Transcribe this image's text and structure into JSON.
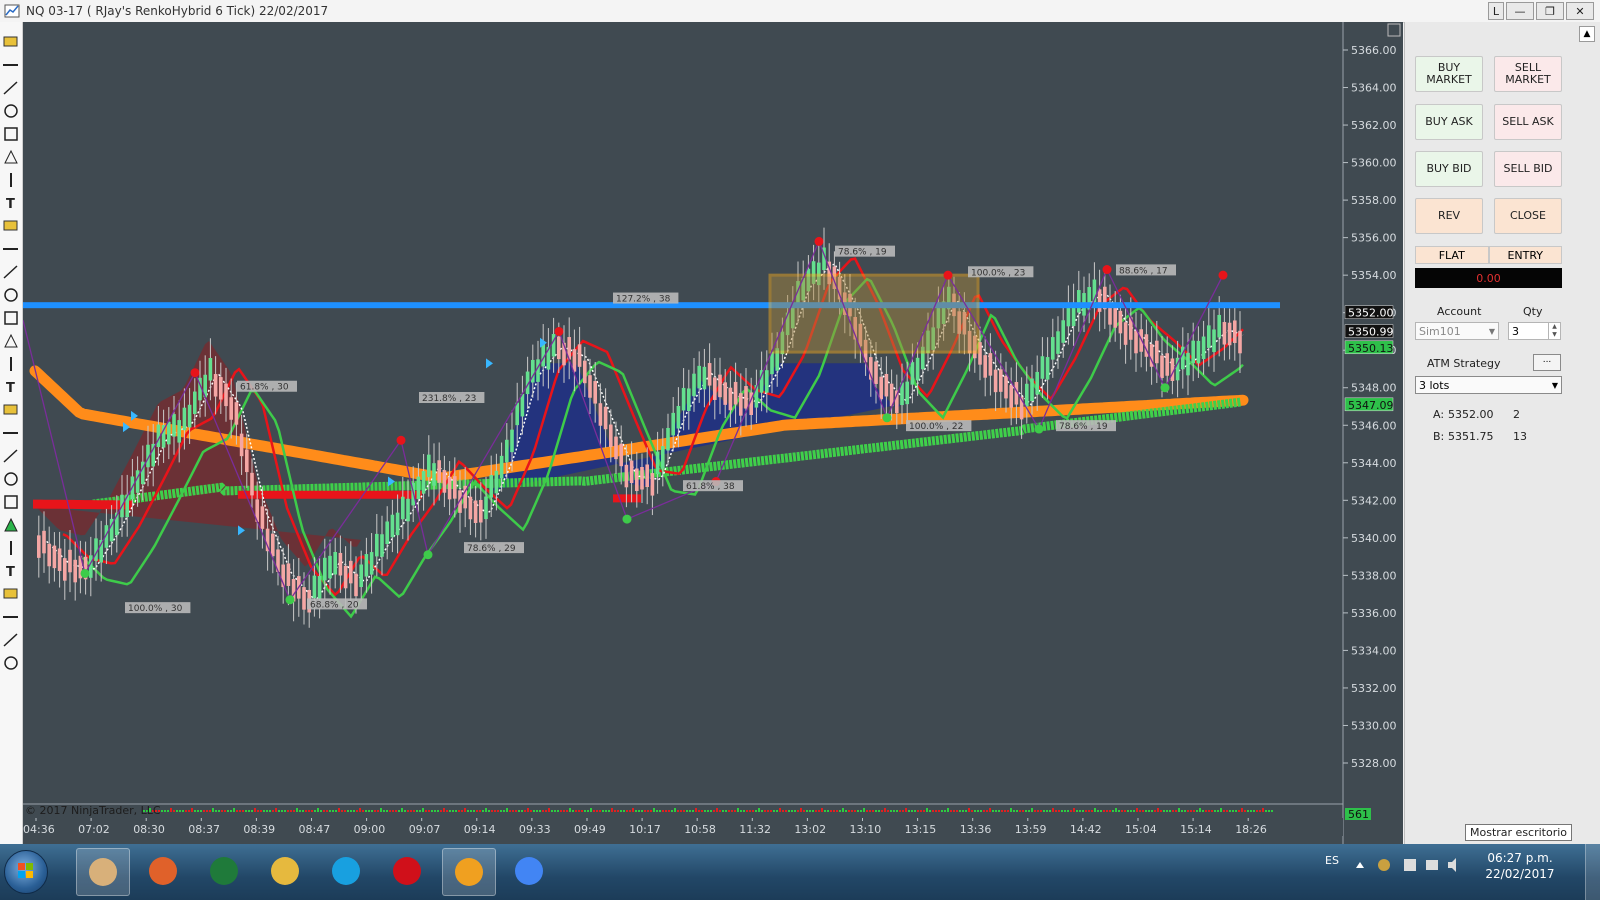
{
  "window": {
    "title": "NQ 03-17 ( RJay's RenkoHybrid  6 Tick)  22/02/2017",
    "buttons": [
      "L",
      "—",
      "❐",
      "✕"
    ]
  },
  "toolbar": {
    "tools": [
      "chart-properties-icon",
      "line-tool-icon",
      "ray-tool-icon",
      "extended-line-icon",
      "arrow-line-icon",
      "horizontal-line-icon",
      "vertical-line-icon",
      "regression-channel-icon",
      "fibonacci-extension-icon",
      "time-cycles-icon",
      "gann-fan-icon",
      "andrews-pitchfork-icon",
      "trend-angle-icon",
      "ruler-icon",
      "pencil-icon",
      "ellipse-icon",
      "rectangle-icon",
      "triangle-icon",
      "arc-icon",
      "text-icon",
      "arrow-up-icon",
      "arrow-down-icon",
      "diamond-icon",
      "dot-icon",
      "square-icon",
      "triangle-up-icon",
      "triangle-down-icon",
      "eraser-icon"
    ]
  },
  "chart": {
    "copyright": "© 2017 NinjaTrader, LLC",
    "colors": {
      "background": "#404a51",
      "bull_candle": "#64e08f",
      "bear_candle": "#f4a6a4",
      "orange_band": "#ff8c1a",
      "green_band": "#3fd04a",
      "red_band": "#e8141a",
      "blue_line": "#1e90ff",
      "zigzag": "#7a2d9a",
      "fill_blue": "#1f2f86",
      "fill_red": "#7a2a2e"
    },
    "price_labels": {
      "last": "5352.00",
      "bid_line": "5350.99",
      "green_tag": "5350.13",
      "lower_tag": "5347.09",
      "volume_tag": "561"
    },
    "fib_labels": [
      "127.2% , 38",
      "78.6% , 19",
      "100.0% , 23",
      "88.6% , 17",
      "61.8% , 30",
      "231.8% , 23",
      "100.0% , 22",
      "78.6% , 19",
      "61.8% , 38",
      "78.6% , 29",
      "100.0% , 30",
      "68.8% , 20"
    ]
  },
  "chart_data": {
    "type": "candlestick",
    "instrument": "NQ 03-17",
    "bar_type": "RJay's RenkoHybrid  6 Tick",
    "y_ticks": [
      "5366.00",
      "5364.00",
      "5362.00",
      "5360.00",
      "5358.00",
      "5356.00",
      "5354.00",
      "5352.00",
      "5350.00",
      "5348.00",
      "5346.00",
      "5344.00",
      "5342.00",
      "5340.00",
      "5338.00",
      "5336.00",
      "5334.00",
      "5332.00",
      "5330.00",
      "5328.00"
    ],
    "ylim": [
      5327,
      5367
    ],
    "x_ticks": [
      "04:36",
      "07:02",
      "08:30",
      "08:37",
      "08:39",
      "08:47",
      "09:00",
      "09:07",
      "09:14",
      "09:33",
      "09:49",
      "10:17",
      "10:58",
      "11:32",
      "13:02",
      "13:10",
      "13:15",
      "13:36",
      "13:59",
      "14:42",
      "15:04",
      "15:14",
      "18:26"
    ],
    "horizontal_line": 5352.4,
    "close_path": [
      5339.9,
      5338.6,
      5338.3,
      5340.3,
      5342.8,
      5345.4,
      5346.1,
      5348.8,
      5346.9,
      5341.3,
      5338.1,
      5336.6,
      5338.8,
      5337.6,
      5339.8,
      5341.6,
      5343.8,
      5342.4,
      5341.2,
      5344.2,
      5348.6,
      5350.2,
      5349.6,
      5346.4,
      5343.3,
      5343.1,
      5346.6,
      5348.8,
      5347.6,
      5347.2,
      5349.5,
      5353.3,
      5354.7,
      5352.1,
      5348.6,
      5347.2,
      5349.8,
      5352.8,
      5350.2,
      5348.4,
      5347.1,
      5349.3,
      5352.1,
      5353.1,
      5351.3,
      5350.2,
      5348.9,
      5349.8,
      5351.1,
      5350.6
    ]
  },
  "order_panel": {
    "buy_market": "BUY MARKET",
    "sell_market": "SELL MARKET",
    "buy_ask": "BUY ASK",
    "sell_ask": "SELL ASK",
    "buy_bid": "BUY BID",
    "sell_bid": "SELL BID",
    "rev": "REV",
    "close": "CLOSE",
    "flat": "FLAT",
    "entry": "ENTRY",
    "pnl": "0.00",
    "account_label": "Account",
    "account_value": "Sim101",
    "qty_label": "Qty",
    "qty_value": "3",
    "atm_label": "ATM Strategy",
    "atm_button": "...",
    "atm_value": "3 lots",
    "ask": {
      "label": "A:",
      "price": "5352.00",
      "size": "2"
    },
    "bid": {
      "label": "B:",
      "price": "5351.75",
      "size": "13"
    }
  },
  "tooltip": "Mostrar escritorio",
  "taskbar": {
    "apps": [
      "hand-app-icon",
      "firefox-icon",
      "excel-icon",
      "explorer-icon",
      "skype-icon",
      "opera-icon",
      "ninjatrader-icon",
      "chrome-icon"
    ],
    "language": "ES",
    "time": "06:27 p.m.",
    "date": "22/02/2017"
  }
}
